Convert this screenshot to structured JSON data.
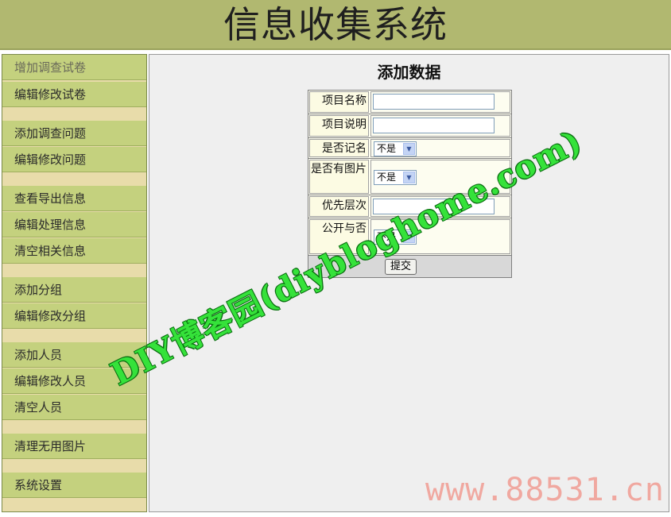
{
  "header": {
    "title": "信息收集系统"
  },
  "sidebar": {
    "items": [
      {
        "label": "增加调查试卷"
      },
      {
        "label": "编辑修改试卷"
      },
      {
        "label": "添加调查问题"
      },
      {
        "label": "编辑修改问题"
      },
      {
        "label": "查看导出信息"
      },
      {
        "label": "编辑处理信息"
      },
      {
        "label": "清空相关信息"
      },
      {
        "label": "添加分组"
      },
      {
        "label": "编辑修改分组"
      },
      {
        "label": "添加人员"
      },
      {
        "label": "编辑修改人员"
      },
      {
        "label": "清空人员"
      },
      {
        "label": "清理无用图片"
      },
      {
        "label": "系统设置"
      }
    ]
  },
  "main": {
    "heading": "添加数据",
    "form": {
      "project_name": {
        "label": "项目名称",
        "value": ""
      },
      "project_desc": {
        "label": "项目说明",
        "value": ""
      },
      "named": {
        "label": "是否记名",
        "value": "不是"
      },
      "has_image": {
        "label": "是否有图片",
        "value": "不是"
      },
      "priority": {
        "label": "优先层次",
        "value": ""
      },
      "public": {
        "label": "公开与否",
        "value": "不是"
      },
      "submit_label": "提交"
    }
  },
  "watermarks": {
    "diagonal": "DIY博客园(diybloghome.com)",
    "corner": "www.88531.cn"
  },
  "colors": {
    "header_bg": "#b1b870",
    "sidebar_item_bg": "#c4d17e",
    "sidebar_sep_bg": "#e8dcaa",
    "main_bg": "#efefef",
    "form_bg": "#fdfdf0",
    "watermark_green": "#35e23a",
    "corner_mark": "#f0a8a0"
  }
}
